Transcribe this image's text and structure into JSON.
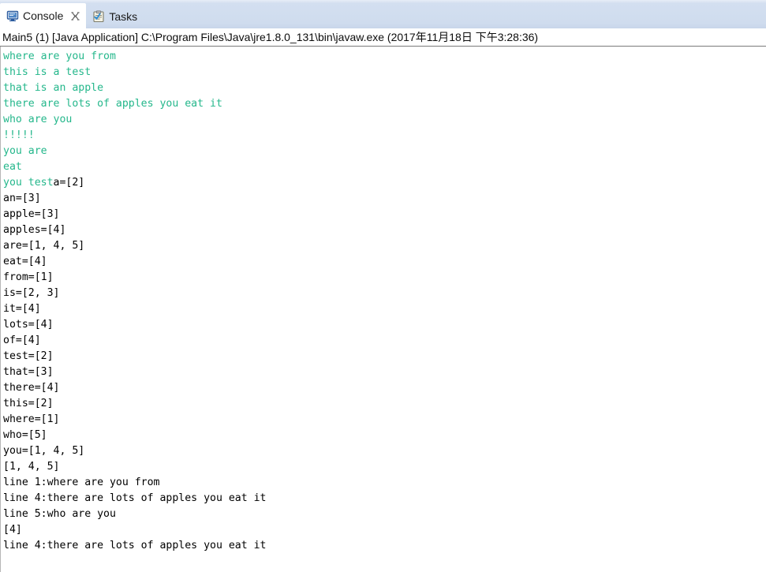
{
  "window": {
    "title": "Eclipse Console View"
  },
  "colors": {
    "tabbar_bg": "#d3dff0",
    "active_tab_bg": "#ffffff",
    "console_bg": "#ffffff",
    "stdout_green": "#24b78b",
    "stdout_black": "#000000",
    "separator": "#7a7a7a"
  },
  "tabs": [
    {
      "id": "console",
      "label": "Console",
      "icon": "console-monitor-icon",
      "active": true,
      "closable": true,
      "close_glyph": "⌧"
    },
    {
      "id": "tasks",
      "label": "Tasks",
      "icon": "tasks-clipboard-icon",
      "active": false,
      "closable": false,
      "close_glyph": ""
    }
  ],
  "process_header": {
    "text": "Main5 (1) [Java Application] C:\\Program Files\\Java\\jre1.8.0_131\\bin\\javaw.exe (2017年11月18日 下午3:28:36)",
    "program": "Main5 (1)",
    "launch_type": "[Java Application]",
    "executable_path": "C:\\Program Files\\Java\\jre1.8.0_131\\bin\\javaw.exe",
    "timestamp": "2017年11月18日 下午3:28:36"
  },
  "console_output": {
    "lines": [
      {
        "segments": [
          {
            "text": "where are you from",
            "color": "green"
          }
        ]
      },
      {
        "segments": [
          {
            "text": "this is a test",
            "color": "green"
          }
        ]
      },
      {
        "segments": [
          {
            "text": "that is an apple",
            "color": "green"
          }
        ]
      },
      {
        "segments": [
          {
            "text": "there are lots of apples you eat it",
            "color": "green"
          }
        ]
      },
      {
        "segments": [
          {
            "text": "who are you",
            "color": "green"
          }
        ]
      },
      {
        "segments": [
          {
            "text": "!!!!!",
            "color": "green"
          }
        ]
      },
      {
        "segments": [
          {
            "text": "you are",
            "color": "green"
          }
        ]
      },
      {
        "segments": [
          {
            "text": "eat",
            "color": "green"
          }
        ]
      },
      {
        "segments": [
          {
            "text": "you test",
            "color": "green"
          },
          {
            "text": "a=[2]",
            "color": "black"
          }
        ]
      },
      {
        "segments": [
          {
            "text": "an=[3]",
            "color": "black"
          }
        ]
      },
      {
        "segments": [
          {
            "text": "apple=[3]",
            "color": "black"
          }
        ]
      },
      {
        "segments": [
          {
            "text": "apples=[4]",
            "color": "black"
          }
        ]
      },
      {
        "segments": [
          {
            "text": "are=[1, 4, 5]",
            "color": "black"
          }
        ]
      },
      {
        "segments": [
          {
            "text": "eat=[4]",
            "color": "black"
          }
        ]
      },
      {
        "segments": [
          {
            "text": "from=[1]",
            "color": "black"
          }
        ]
      },
      {
        "segments": [
          {
            "text": "is=[2, 3]",
            "color": "black"
          }
        ]
      },
      {
        "segments": [
          {
            "text": "it=[4]",
            "color": "black"
          }
        ]
      },
      {
        "segments": [
          {
            "text": "lots=[4]",
            "color": "black"
          }
        ]
      },
      {
        "segments": [
          {
            "text": "of=[4]",
            "color": "black"
          }
        ]
      },
      {
        "segments": [
          {
            "text": "test=[2]",
            "color": "black"
          }
        ]
      },
      {
        "segments": [
          {
            "text": "that=[3]",
            "color": "black"
          }
        ]
      },
      {
        "segments": [
          {
            "text": "there=[4]",
            "color": "black"
          }
        ]
      },
      {
        "segments": [
          {
            "text": "this=[2]",
            "color": "black"
          }
        ]
      },
      {
        "segments": [
          {
            "text": "where=[1]",
            "color": "black"
          }
        ]
      },
      {
        "segments": [
          {
            "text": "who=[5]",
            "color": "black"
          }
        ]
      },
      {
        "segments": [
          {
            "text": "you=[1, 4, 5]",
            "color": "black"
          }
        ]
      },
      {
        "segments": [
          {
            "text": "[1, 4, 5]",
            "color": "black"
          }
        ]
      },
      {
        "segments": [
          {
            "text": "line 1:where are you from",
            "color": "black"
          }
        ]
      },
      {
        "segments": [
          {
            "text": "line 4:there are lots of apples you eat it",
            "color": "black"
          }
        ]
      },
      {
        "segments": [
          {
            "text": "line 5:who are you",
            "color": "black"
          }
        ]
      },
      {
        "segments": [
          {
            "text": "[4]",
            "color": "black"
          }
        ]
      },
      {
        "segments": [
          {
            "text": "line 4:there are lots of apples you eat it",
            "color": "black"
          }
        ]
      }
    ]
  }
}
